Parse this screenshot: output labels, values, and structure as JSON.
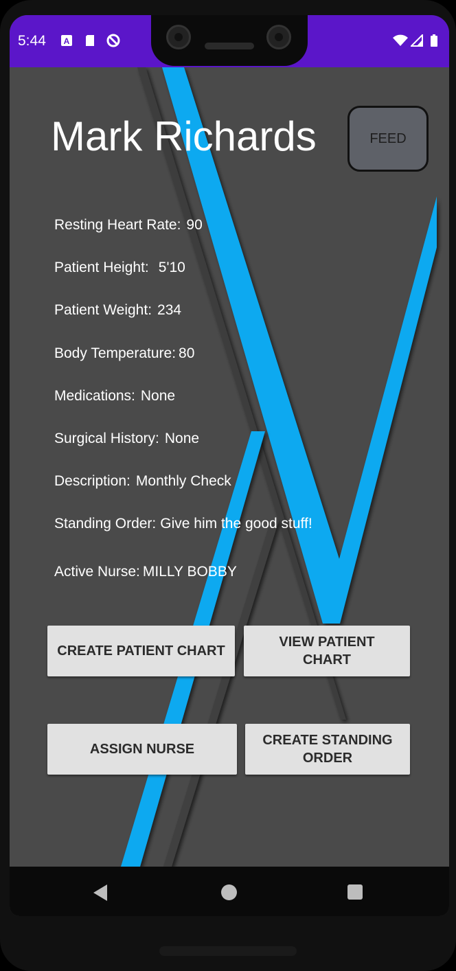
{
  "status_bar": {
    "time": "5:44",
    "color": "#5b16c9"
  },
  "patient": {
    "name": "Mark Richards"
  },
  "feed_button": "FEED",
  "details": [
    {
      "label": "Resting Heart Rate:",
      "value": "90"
    },
    {
      "label": "Patient Height:",
      "value": "5'10"
    },
    {
      "label": "Patient Weight:",
      "value": "234"
    },
    {
      "label": "Body Temperature:",
      "value": "80"
    },
    {
      "label": "Medications:",
      "value": "None"
    },
    {
      "label": "Surgical History:",
      "value": "None"
    },
    {
      "label": "Description:",
      "value": "Monthly Check"
    },
    {
      "label": "Standing Order:",
      "value": "Give him the good stuff!"
    },
    {
      "label": "Active Nurse:",
      "value": "MILLY BOBBY"
    }
  ],
  "buttons": {
    "create_patient_chart": "CREATE PATIENT CHART",
    "view_patient_chart": "VIEW PATIENT CHART",
    "assign_nurse": "ASSIGN NURSE",
    "create_standing_order": "CREATE STANDING ORDER"
  },
  "colors": {
    "background": "#4a4a4a",
    "accent_stripe": "#0aa9f0",
    "button_bg": "#e1e1e1"
  },
  "nav_icons": [
    "back-icon",
    "home-icon",
    "recents-icon"
  ]
}
